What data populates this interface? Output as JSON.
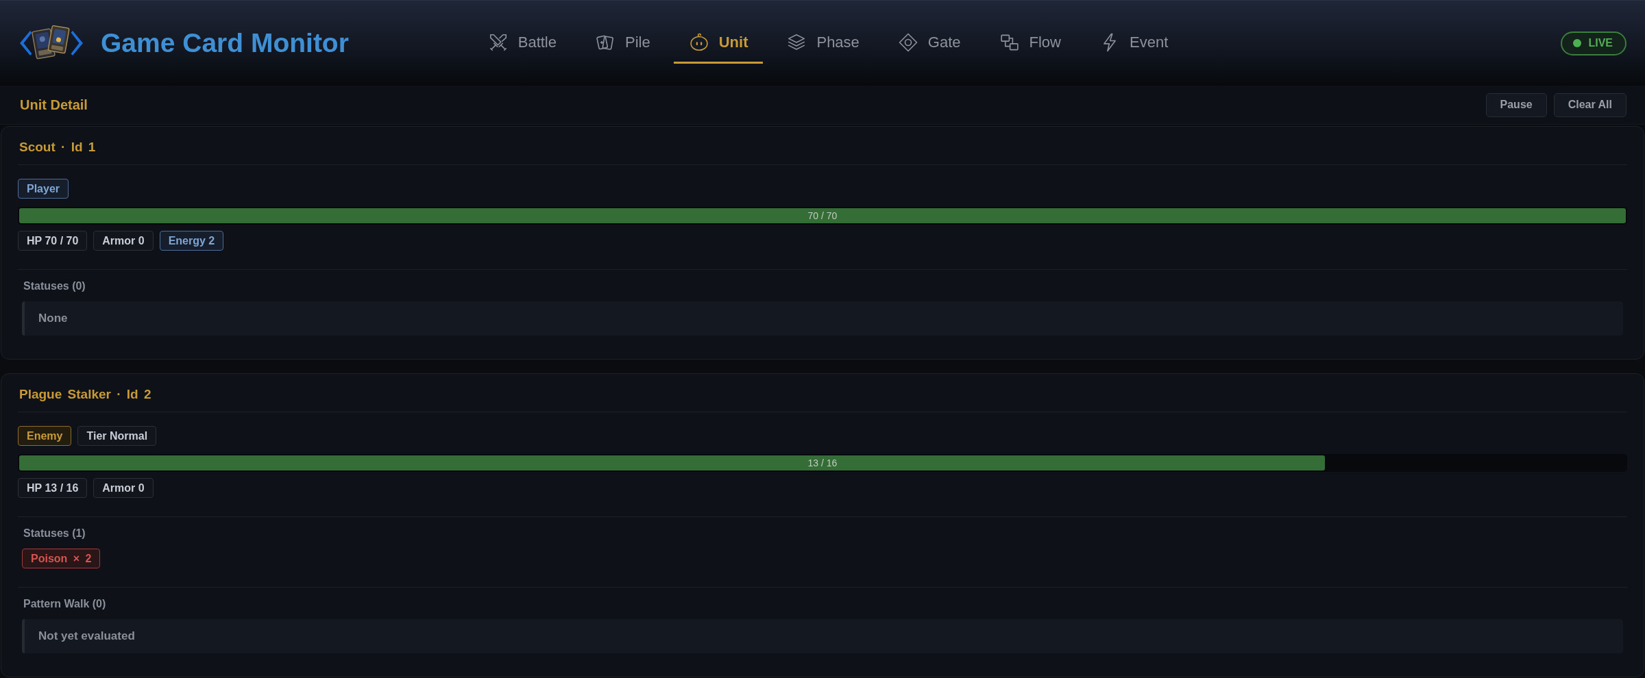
{
  "header": {
    "title": "Game Card Monitor",
    "tabs": [
      {
        "label": "Battle",
        "selected": false
      },
      {
        "label": "Pile",
        "selected": false
      },
      {
        "label": "Unit",
        "selected": true
      },
      {
        "label": "Phase",
        "selected": false
      },
      {
        "label": "Gate",
        "selected": false
      },
      {
        "label": "Flow",
        "selected": false
      },
      {
        "label": "Event",
        "selected": false
      }
    ],
    "live_badge": {
      "label": "LIVE"
    }
  },
  "panel": {
    "title": "Unit Detail",
    "buttons": [
      {
        "label": "Pause"
      },
      {
        "label": "Clear All"
      }
    ]
  },
  "units": [
    {
      "title": "Scout · Id 1",
      "tags": [
        {
          "label": "Player",
          "kind": "player"
        }
      ],
      "hp_bar": {
        "level": 1,
        "reading": "70 / 70"
      },
      "stats": [
        {
          "label": "HP 70 / 70",
          "kind": "plain"
        },
        {
          "label": "Armor 0",
          "kind": "plain"
        },
        {
          "label": "Energy 2",
          "kind": "energy"
        }
      ],
      "sections": [
        {
          "title": "Statuses (0)",
          "kind": "empty",
          "text": "None"
        }
      ]
    },
    {
      "title": "Plague Stalker · Id 2",
      "tags": [
        {
          "label": "Enemy",
          "kind": "enemy"
        },
        {
          "label": "Tier Normal",
          "kind": "plain"
        }
      ],
      "hp_bar": {
        "level": 0.8125,
        "reading": "13 / 16"
      },
      "stats": [
        {
          "label": "HP 13 / 16",
          "kind": "plain"
        },
        {
          "label": "Armor 0",
          "kind": "plain"
        }
      ],
      "sections": [
        {
          "title": "Statuses (1)",
          "kind": "statuses",
          "items": [
            {
              "label": "Poison × 2",
              "kind": "debuff"
            }
          ]
        },
        {
          "title": "Pattern Walk (0)",
          "kind": "empty",
          "text": "Not yet evaluated"
        }
      ]
    }
  ]
}
